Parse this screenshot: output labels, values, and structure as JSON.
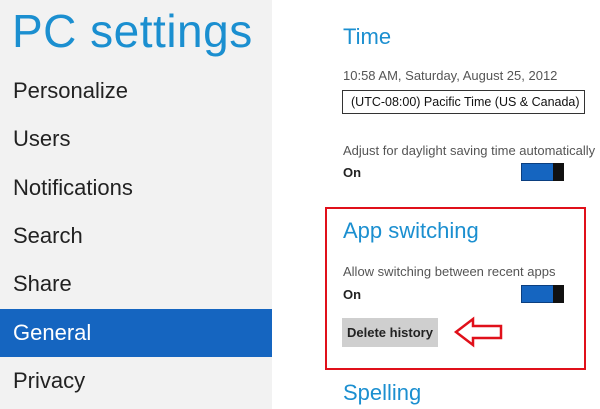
{
  "sidebar": {
    "title": "PC settings",
    "items": [
      {
        "label": "Personalize"
      },
      {
        "label": "Users"
      },
      {
        "label": "Notifications"
      },
      {
        "label": "Search"
      },
      {
        "label": "Share"
      },
      {
        "label": "General",
        "selected": true
      },
      {
        "label": "Privacy"
      }
    ]
  },
  "time": {
    "heading": "Time",
    "current": "10:58 AM, Saturday, August 25, 2012",
    "timezone_value": "(UTC-08:00) Pacific Time (US & Canada)",
    "dst_label": "Adjust for daylight saving time automatically",
    "dst_state": "On"
  },
  "app_switching": {
    "heading": "App switching",
    "allow_label": "Allow switching between recent apps",
    "allow_state": "On",
    "delete_label": "Delete history"
  },
  "spelling": {
    "heading": "Spelling"
  },
  "colors": {
    "accent": "#1b8fd0",
    "selected_bg": "#1565c0",
    "highlight": "#e0101a"
  },
  "icons": [
    "toggle-switch",
    "red-arrow-annotation"
  ]
}
